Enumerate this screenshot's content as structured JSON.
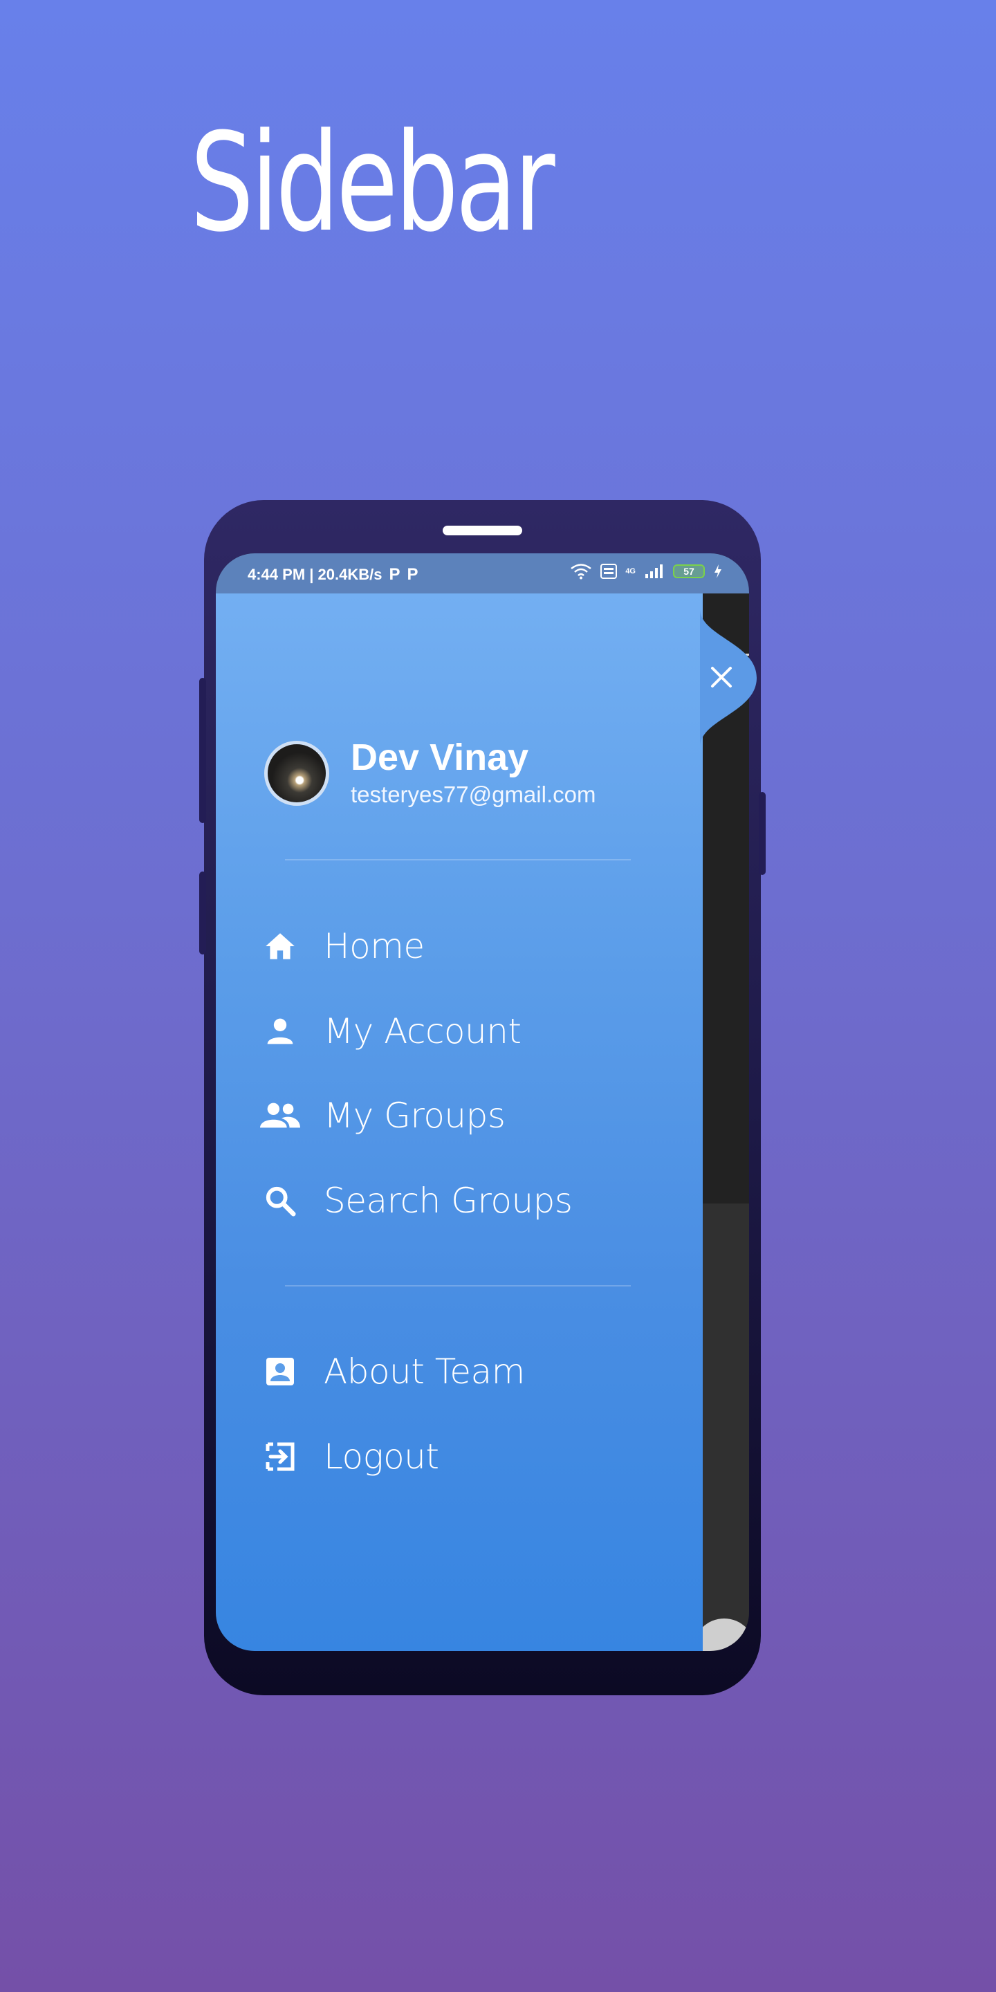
{
  "hero": {
    "title": "Sidebar"
  },
  "status_bar": {
    "time_speed": "4:44 PM | 20.4KB/s",
    "app_icon_1": "P",
    "app_icon_2": "P",
    "network": "4G",
    "battery_level": "57"
  },
  "profile": {
    "name": "Dev Vinay",
    "email": "testeryes77@gmail.com"
  },
  "menu": {
    "primary": [
      {
        "label": "Home",
        "icon": "home-icon"
      },
      {
        "label": "My Account",
        "icon": "person-icon"
      },
      {
        "label": "My Groups",
        "icon": "group-icon"
      },
      {
        "label": "Search Groups",
        "icon": "search-icon"
      }
    ],
    "secondary": [
      {
        "label": "About Team",
        "icon": "contact-card-icon"
      },
      {
        "label": "Logout",
        "icon": "logout-icon"
      }
    ]
  },
  "colors": {
    "background_top": "#6880ea",
    "background_bottom": "#7450a8",
    "drawer_top": "#73aff2",
    "drawer_bottom": "#3785e1",
    "accent": "#5b9de9"
  }
}
